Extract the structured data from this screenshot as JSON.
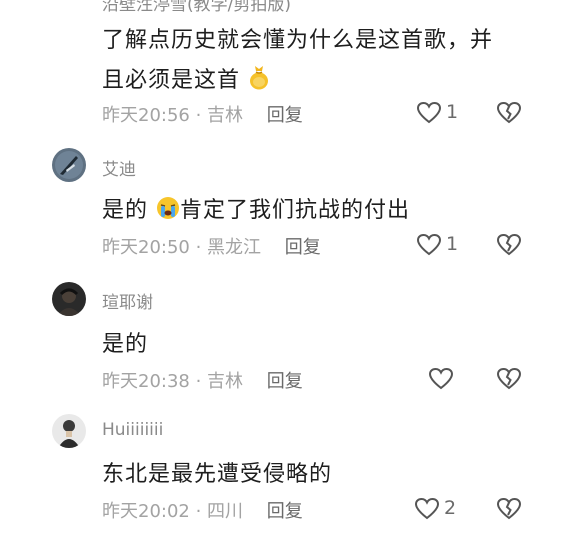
{
  "comments": [
    {
      "name": "沿壁泩渟雪(教学/剪拍版)",
      "text_line1": "了解点历史就会懂为什么是这首歌，并",
      "text_line2": "且必须是这首",
      "time": "昨天20:56",
      "location": "吉林",
      "reply": "回复",
      "likes": "1"
    },
    {
      "name": "艾迪",
      "text_before": "是的",
      "text_after": "肯定了我们抗战的付出",
      "time": "昨天20:50",
      "location": "黑龙江",
      "reply": "回复",
      "likes": "1"
    },
    {
      "name": "瑄耶谢",
      "text": "是的",
      "time": "昨天20:38",
      "location": "吉林",
      "reply": "回复",
      "likes": ""
    },
    {
      "name": "Huiiiiiiii",
      "text": "东北是最先遭受侵略的",
      "time": "昨天20:02",
      "location": "四川",
      "reply": "回复",
      "likes": "2"
    }
  ],
  "separator": " · ",
  "colors": {
    "meta": "#a3a3a3",
    "text": "#1e1e1e",
    "name": "#8a8a8a",
    "icon": "#555555"
  },
  "icons": {
    "like": "heart-outline-icon",
    "dislike": "broken-heart-icon",
    "emoji_1": "money-bag-emoji-icon",
    "emoji_2": "crying-face-emoji-icon"
  }
}
